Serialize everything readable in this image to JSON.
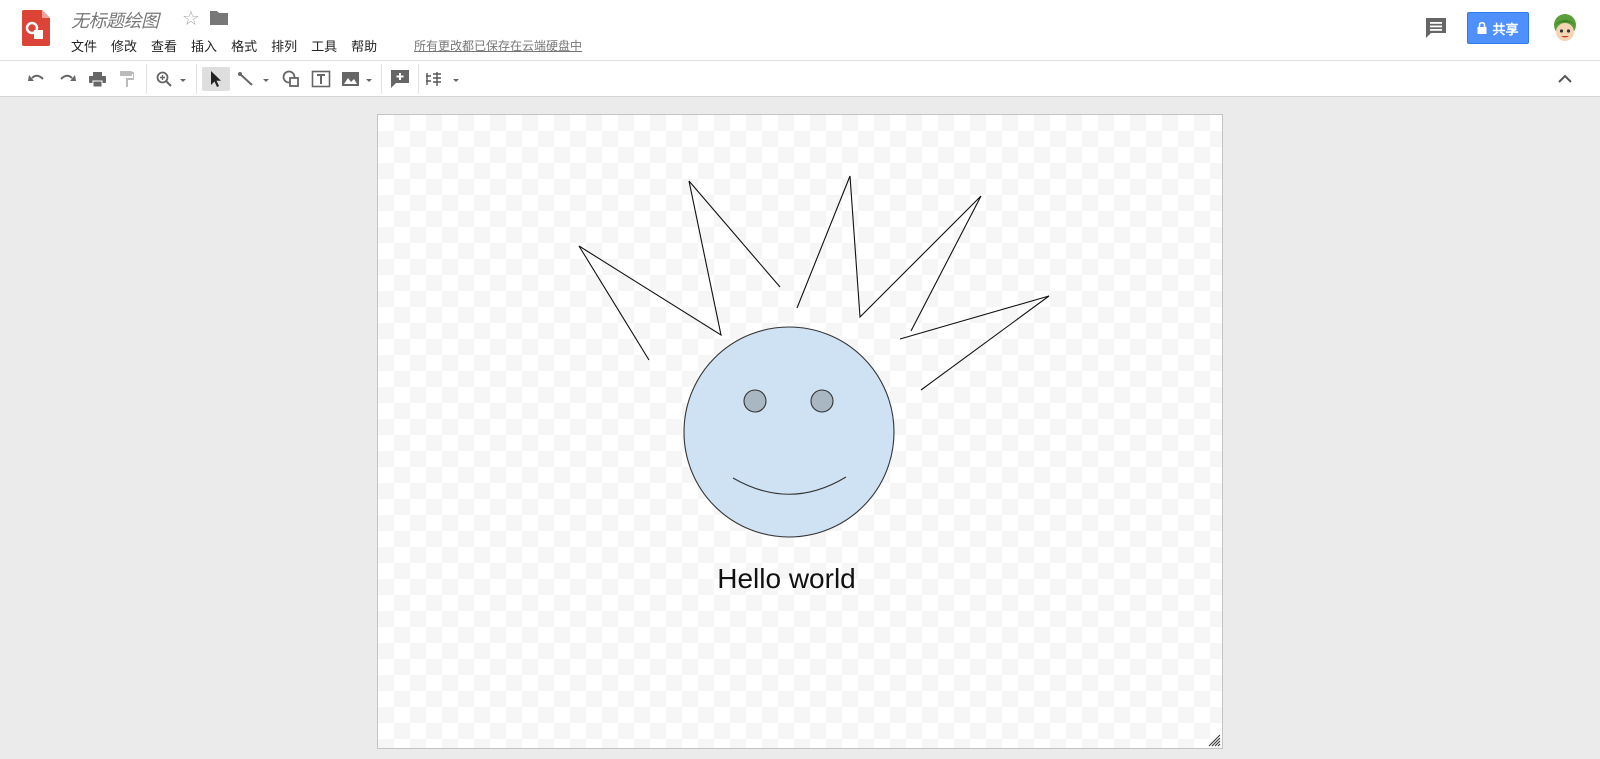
{
  "header": {
    "title": "无标题绘图",
    "save_status": "所有更改都已保存在云端硬盘中",
    "share_label": "共享"
  },
  "menu": {
    "items": [
      {
        "label": "文件"
      },
      {
        "label": "修改"
      },
      {
        "label": "查看"
      },
      {
        "label": "插入"
      },
      {
        "label": "格式"
      },
      {
        "label": "排列"
      },
      {
        "label": "工具"
      },
      {
        "label": "帮助"
      }
    ]
  },
  "toolbar": {
    "icons": [
      "undo-icon",
      "redo-icon",
      "print-icon",
      "paint-format-icon",
      "zoom-icon",
      "select-icon",
      "line-icon",
      "shape-icon",
      "textbox-icon",
      "image-icon",
      "add-comment-icon",
      "arrange-icon",
      "collapse-icon"
    ]
  },
  "canvas": {
    "text": "Hello world"
  },
  "colors": {
    "accent": "#4d90fe",
    "logo": "#db4437",
    "face_fill": "#cfe2f3",
    "eye_fill": "#a9b7c2"
  }
}
